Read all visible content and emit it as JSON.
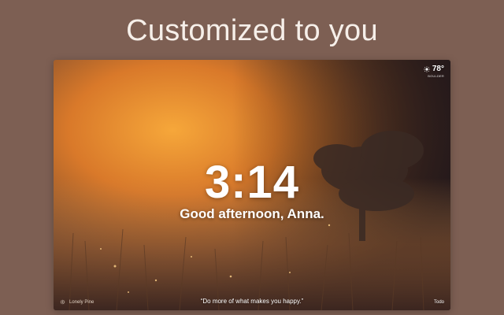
{
  "headline": "Customized to you",
  "clock": {
    "time": "3:14"
  },
  "greeting": "Good afternoon, Anna.",
  "weather": {
    "temperature": "78°",
    "location": "BOULDER",
    "icon": "sun-icon"
  },
  "footer": {
    "photo_credit": "Lonely Pine",
    "quote": "“Do more of what makes you happy.”",
    "todo_label": "Todo"
  },
  "colors": {
    "page_background": "#7d5f53",
    "headline_text": "#f6efe9",
    "scene_glow": "#e7902c",
    "scene_dark": "#2a1e1a"
  }
}
